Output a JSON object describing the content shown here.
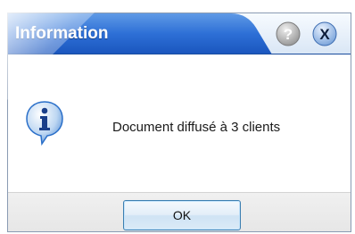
{
  "dialog": {
    "title": "Information",
    "message": "Document diffusé à 3 clients",
    "ok_label": "OK",
    "help_label": "?",
    "close_label": "X"
  },
  "icons": {
    "help": "help-icon",
    "close": "close-icon",
    "info": "info-icon"
  },
  "colors": {
    "titlebar_start": "#1d62c9",
    "titlebar_end": "#5a94e2",
    "ok_border": "#3c7fb1",
    "info_icon": "#2a6fc9"
  }
}
